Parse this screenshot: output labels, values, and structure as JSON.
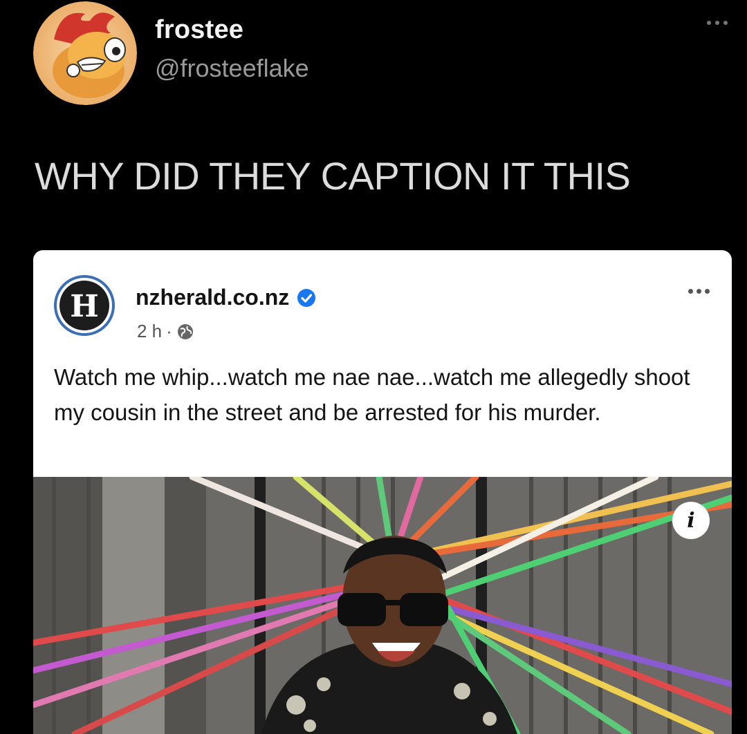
{
  "tweet": {
    "display_name": "frostee",
    "handle": "@frosteeflake",
    "text": "WHY DID THEY CAPTION IT THIS",
    "avatar_icon": "red-rooster-character-avatar",
    "more_icon": "more-horizontal-icon"
  },
  "embedded_post": {
    "page_name": "nzherald.co.nz",
    "verified_icon": "verified-badge-icon",
    "time": "2 h",
    "separator": "·",
    "audience_icon": "globe-icon",
    "logo_letter": "H",
    "text": "Watch me whip...watch me nae nae...watch me allegedly shoot my cousin in the street and be arrested for his murder.",
    "info_icon": "i",
    "photo": "man-in-sunglasses-with-colorful-streamers",
    "colors": {
      "verified": "#1877f2",
      "logo_ring": "#3b6fb6"
    }
  }
}
